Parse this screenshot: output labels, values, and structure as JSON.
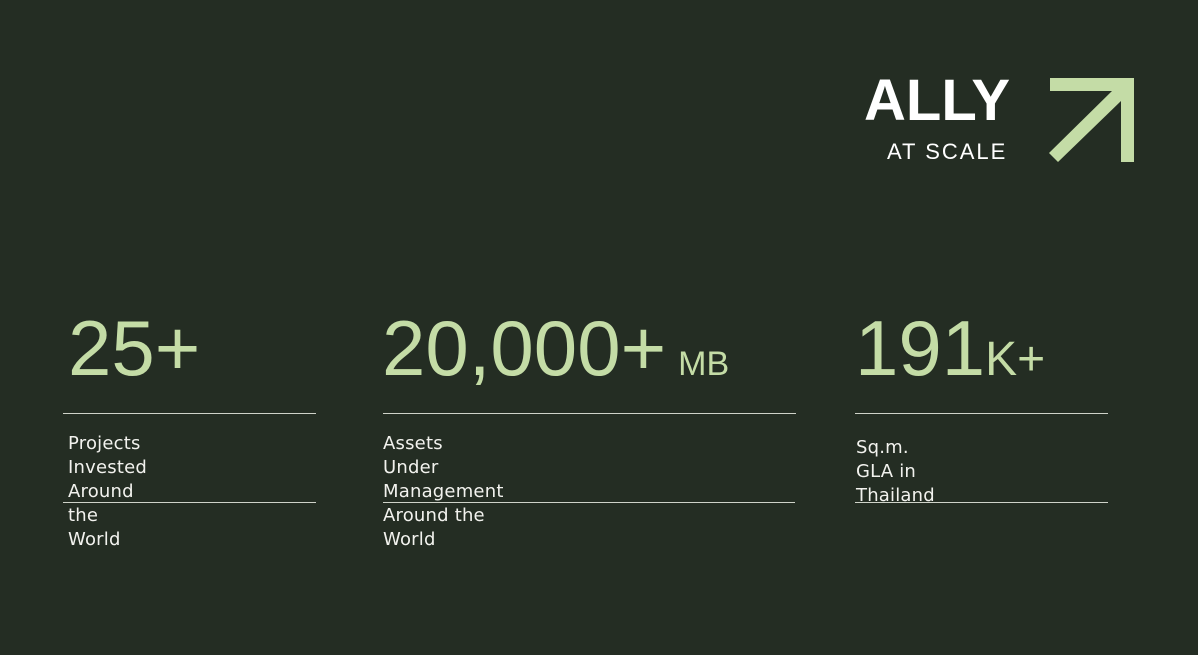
{
  "logo": {
    "wordmark": "ALLY",
    "tagline": "AT SCALE",
    "icon": "arrow-up-right-icon",
    "accent_color": "#c4dca6"
  },
  "stats": [
    {
      "value": "25+",
      "suffix": "",
      "unit": "",
      "label_lines": [
        "Projects Invested",
        "Around the World"
      ]
    },
    {
      "value": "20,000+",
      "suffix": "",
      "unit": "MB",
      "label_lines": [
        "Assets Under Management",
        "Around the World"
      ]
    },
    {
      "value": "191",
      "suffix": "K+",
      "unit": "",
      "label_lines": [
        "Sq.m. GLA in Thailand"
      ]
    }
  ],
  "colors": {
    "background": "#242d23",
    "value_text": "#c4dca6",
    "label_text": "#f2f2ee",
    "rule": "#cfd3c9"
  }
}
